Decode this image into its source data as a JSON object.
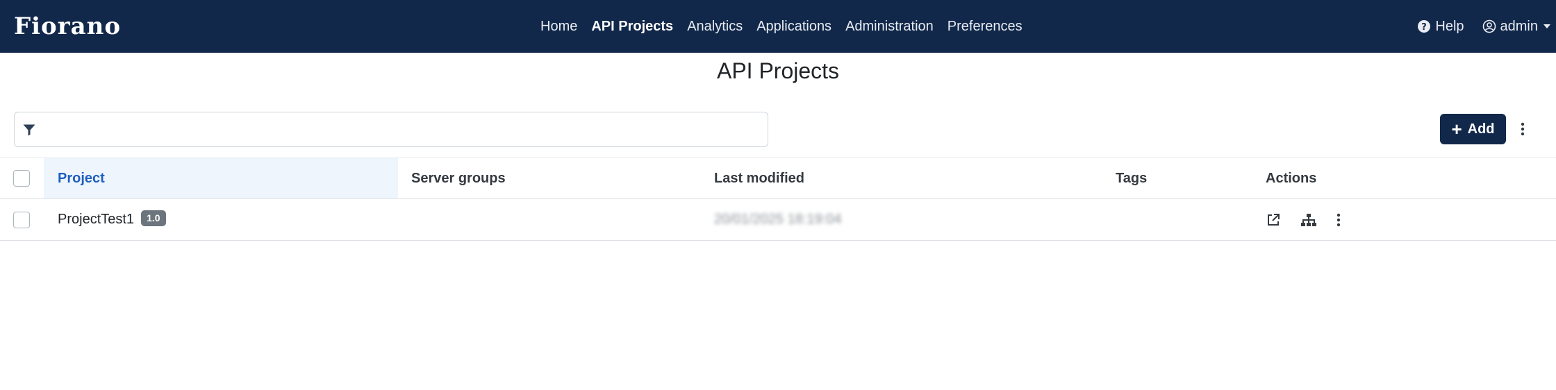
{
  "navbar": {
    "brand": "Fiorano",
    "links": [
      "Home",
      "API Projects",
      "Analytics",
      "Applications",
      "Administration",
      "Preferences"
    ],
    "active": "API Projects",
    "help_label": "Help",
    "user_label": "admin"
  },
  "page": {
    "title": "API Projects"
  },
  "filter": {
    "value": "",
    "placeholder": ""
  },
  "toolbar": {
    "add_label": "Add"
  },
  "table": {
    "columns": [
      "Project",
      "Server groups",
      "Last modified",
      "Tags",
      "Actions"
    ],
    "rows": [
      {
        "project": "ProjectTest1",
        "version": "1.0",
        "server_groups": "",
        "last_modified": "20/01/2025 18:19:04",
        "tags": ""
      }
    ]
  },
  "icons": {
    "filter": "funnel-icon",
    "help": "question-circle-icon",
    "user": "person-circle-icon",
    "more": "kebab-icon",
    "open": "external-link-icon",
    "deploy": "sitemap-icon"
  },
  "colors": {
    "navbar": "#12284a",
    "accent": "#1f5fbf",
    "badge": "#6c757d",
    "header_highlight": "#eef5fd"
  }
}
